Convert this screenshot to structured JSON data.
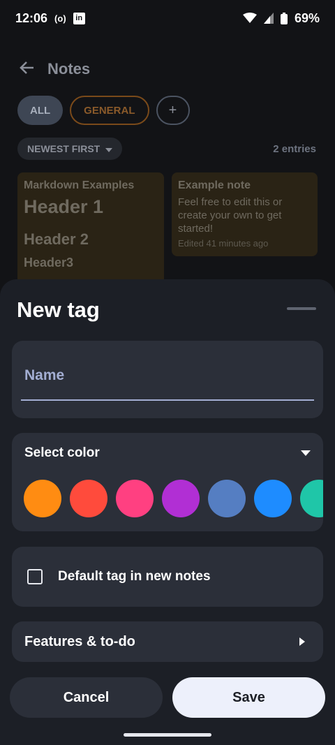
{
  "status_bar": {
    "time": "12:06",
    "cast_icon": "(o)",
    "linkedin_icon": "in",
    "battery": "69%"
  },
  "background": {
    "app_title": "Notes",
    "chips": [
      "ALL",
      "GENERAL",
      "+"
    ],
    "sort_label": "NEWEST FIRST",
    "entries_count": "2 entries",
    "notes": [
      {
        "title": "Markdown Examples",
        "h1": "Header 1",
        "h2": "Header 2",
        "h3": "Header3"
      },
      {
        "title": "Example note",
        "body": "Feel free to edit this or create your own to get started!",
        "meta": "Edited 41 minutes ago"
      }
    ]
  },
  "sheet": {
    "title": "New tag",
    "name_label": "Name",
    "select_color_label": "Select color",
    "colors": [
      "#ff8c12",
      "#ff4b3c",
      "#ff4081",
      "#b12fd4",
      "#557ec2",
      "#1e8cff",
      "#1fc6a8"
    ],
    "default_tag_label": "Default tag in new notes",
    "features_label": "Features & to-do",
    "cancel_label": "Cancel",
    "save_label": "Save"
  }
}
